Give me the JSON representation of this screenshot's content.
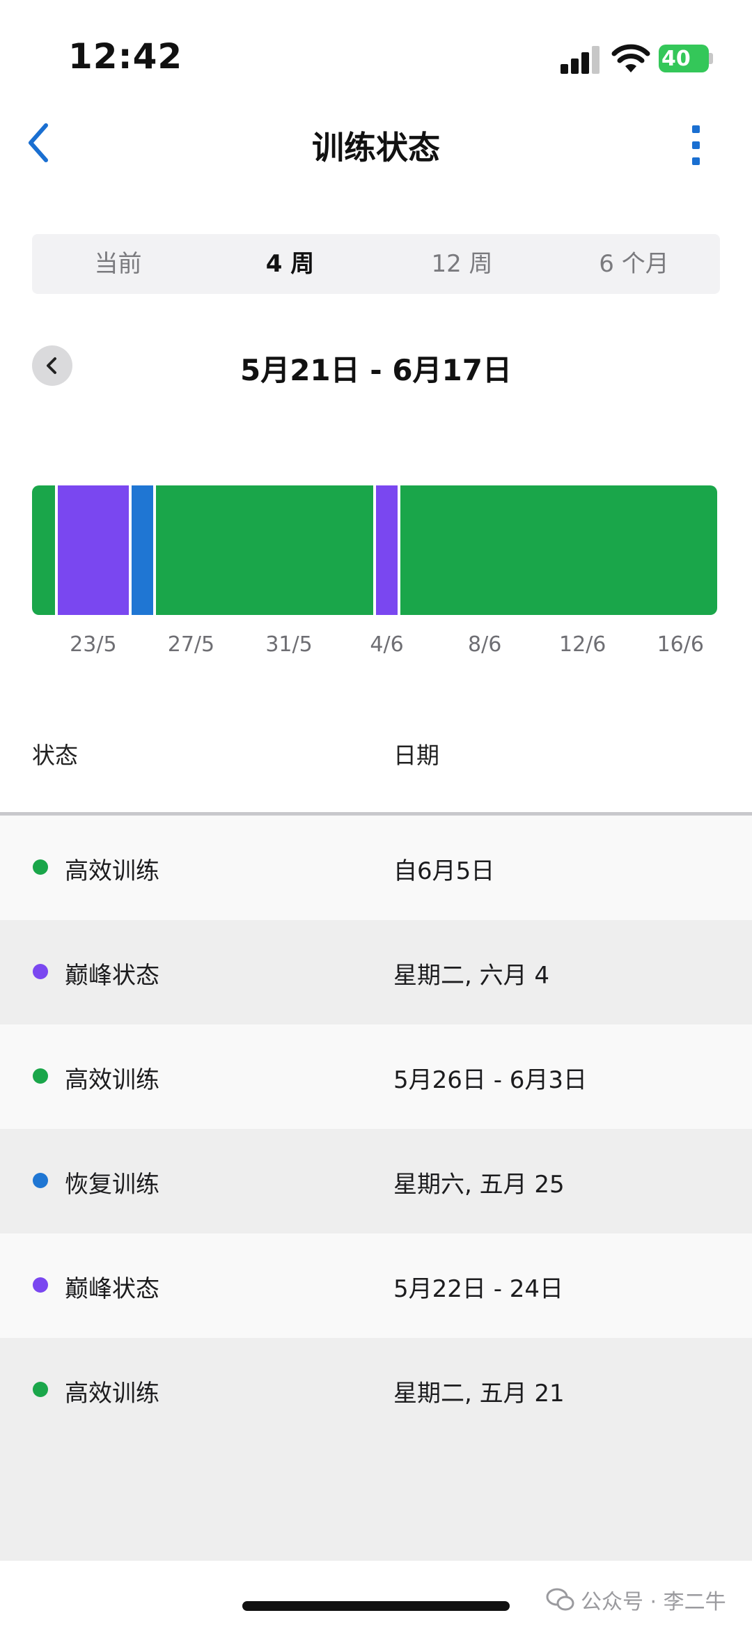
{
  "status_bar": {
    "time": "12:42",
    "battery": "40"
  },
  "nav": {
    "title": "训练状态"
  },
  "segments": [
    {
      "label": "当前",
      "active": false
    },
    {
      "label": "4 周",
      "active": true
    },
    {
      "label": "12 周",
      "active": false
    },
    {
      "label": "6 个月",
      "active": false
    }
  ],
  "date_range": "5月21日 - 6月17日",
  "chart_data": {
    "type": "bar",
    "orientation": "timeline",
    "x_range": [
      "5/21",
      "6/17"
    ],
    "tick_labels": [
      "23/5",
      "27/5",
      "31/5",
      "4/6",
      "8/6",
      "12/6",
      "16/6"
    ],
    "segments": [
      {
        "state": "高效训练",
        "start": "5/21",
        "end": "5/21",
        "color": "#1aa64a"
      },
      {
        "state": "巅峰状态",
        "start": "5/22",
        "end": "5/24",
        "color": "#7a47f0"
      },
      {
        "state": "恢复训练",
        "start": "5/25",
        "end": "5/25",
        "color": "#1f76d3"
      },
      {
        "state": "高效训练",
        "start": "5/26",
        "end": "6/3",
        "color": "#1aa64a"
      },
      {
        "state": "巅峰状态",
        "start": "6/4",
        "end": "6/4",
        "color": "#7a47f0"
      },
      {
        "state": "高效训练",
        "start": "6/5",
        "end": "6/17",
        "color": "#1aa64a"
      }
    ]
  },
  "table": {
    "headers": {
      "state": "状态",
      "date": "日期"
    },
    "rows": [
      {
        "state": "高效训练",
        "date": "自6月5日",
        "color": "#1aa64a"
      },
      {
        "state": "巅峰状态",
        "date": "星期二, 六月 4",
        "color": "#7a47f0"
      },
      {
        "state": "高效训练",
        "date": "5月26日 - 6月3日",
        "color": "#1aa64a"
      },
      {
        "state": "恢复训练",
        "date": "星期六, 五月 25",
        "color": "#1f76d3"
      },
      {
        "state": "巅峰状态",
        "date": "5月22日 - 24日",
        "color": "#7a47f0"
      },
      {
        "state": "高效训练",
        "date": "星期二, 五月 21",
        "color": "#1aa64a"
      }
    ]
  },
  "watermark": "公众号 · 李二牛",
  "icons": {
    "back": "chevron-left-icon",
    "more": "more-vertical-icon",
    "prev": "chevron-left-icon",
    "wechat": "wechat-icon"
  },
  "colors": {
    "accent": "#1a6fd1",
    "productive": "#1aa64a",
    "peaking": "#7a47f0",
    "recovery": "#1f76d3"
  }
}
